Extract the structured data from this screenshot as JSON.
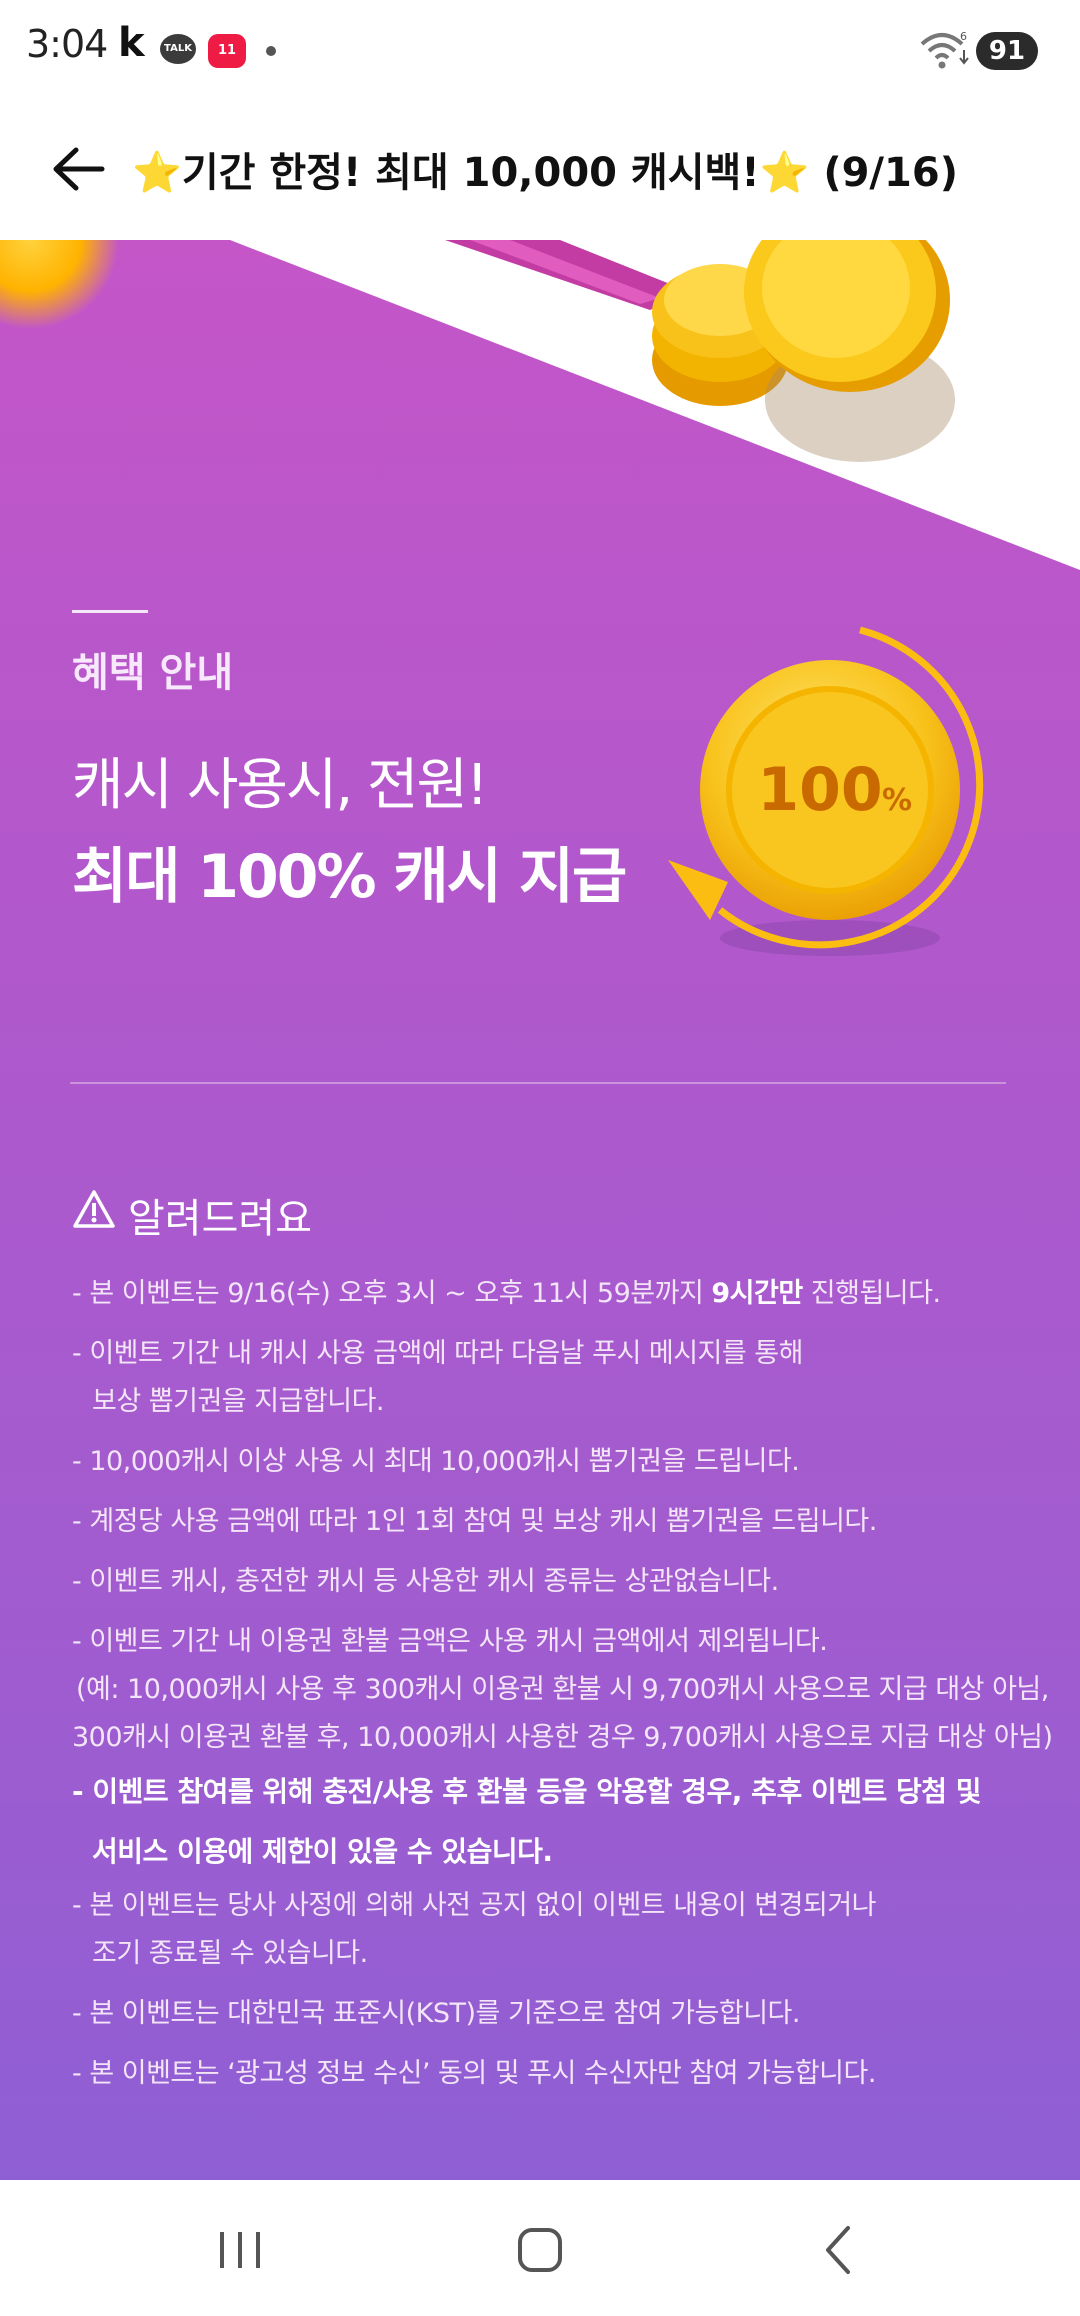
{
  "status_bar": {
    "time": "3:04",
    "kakao_k": "k",
    "talk_badge": "TALK",
    "eleven_badge": "11",
    "battery": "91",
    "wifi_badge": "6"
  },
  "header": {
    "title_star": "⭐",
    "title_text": "기간 한정! 최대 10,000 캐시백!",
    "title_suffix": "(9/16)"
  },
  "banner": {
    "benefit_label": "혜택 안내",
    "headline_line1": "캐시 사용시, 전원!",
    "headline_line2": "최대 100% 캐시 지급",
    "coin_text_num": "100",
    "coin_text_pct": "%"
  },
  "notice": {
    "title": "알려드려요",
    "items": [
      {
        "pre": "- 본 이벤트는 9/16(수) 오후 3시 ~ 오후 11시 59분까지 ",
        "bold": "9시간만",
        "post": " 진행됩니다."
      },
      {
        "line1": "- 이벤트 기간 내 캐시 사용 금액에 따라 다음날 푸시 메시지를 통해",
        "line2": "보상 뽑기권을 지급합니다."
      },
      {
        "text": "- 10,000캐시 이상 사용 시 최대 10,000캐시 뽑기권을 드립니다."
      },
      {
        "text": "- 계정당 사용 금액에 따라 1인 1회 참여 및 보상 캐시 뽑기권을 드립니다."
      },
      {
        "text": "- 이벤트 캐시, 충전한 캐시 등 사용한 캐시 종류는 상관없습니다."
      },
      {
        "line1": "- 이벤트 기간 내 이용권 환불 금액은 사용 캐시 금액에서 제외됩니다.",
        "line2": "(예: 10,000캐시 사용 후 300캐시 이용권 환불 시 9,700캐시 사용으로 지급 대상 아님,",
        "line3": "300캐시 이용권 환불 후, 10,000캐시 사용한 경우 9,700캐시 사용으로 지급 대상 아님)"
      },
      {
        "line1": "- 이벤트 참여를 위해 충전/사용 후 환불 등을 악용할 경우, 추후 이벤트 당첨 및",
        "line2": "서비스 이용에 제한이 있을 수 있습니다."
      },
      {
        "line1": "- 본 이벤트는 당사 사정에 의해 사전 공지 없이 이벤트 내용이 변경되거나",
        "line2": "조기 종료될 수 있습니다."
      },
      {
        "text": "- 본 이벤트는 대한민국 표준시(KST)를 기준으로 참여 가능합니다."
      },
      {
        "text": "- 본 이벤트는 ‘광고성 정보 수신’ 동의 및 푸시 수신자만 참여 가능합니다."
      }
    ]
  },
  "navbar": {
    "recent_icon": "recent-apps-icon",
    "home_icon": "home-icon",
    "back_icon": "back-icon"
  },
  "colors": {
    "banner_top": "#c456c8",
    "banner_bottom": "#8f5fd4",
    "coin_gold": "#f8c21b",
    "star": "#f5b400"
  }
}
